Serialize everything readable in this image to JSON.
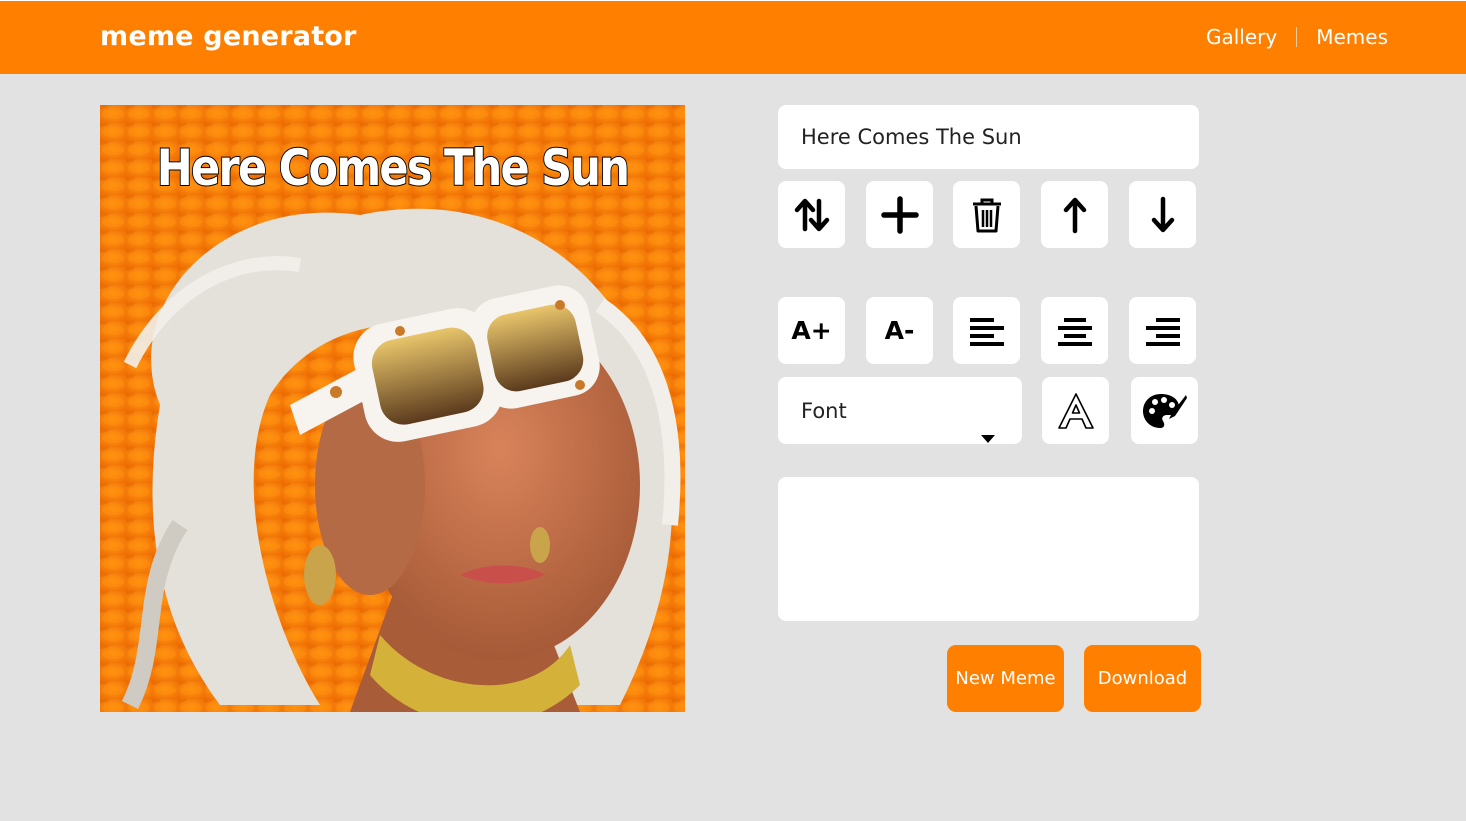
{
  "header": {
    "logo": "meme generator",
    "nav": [
      {
        "label": "Gallery"
      },
      {
        "label": "Memes"
      }
    ]
  },
  "meme": {
    "caption": "Here Comes The Sun"
  },
  "editor": {
    "line_text_value": "Here Comes The Sun",
    "row1": [
      {
        "icon": "swap-vertical-icon",
        "label": ""
      },
      {
        "icon": "plus-icon",
        "label": ""
      },
      {
        "icon": "trash-icon",
        "label": ""
      },
      {
        "icon": "arrow-up-icon",
        "label": ""
      },
      {
        "icon": "arrow-down-icon",
        "label": ""
      }
    ],
    "row2": [
      {
        "icon": "font-increase-icon",
        "label": "A+"
      },
      {
        "icon": "font-decrease-icon",
        "label": "A-"
      },
      {
        "icon": "align-left-icon"
      },
      {
        "icon": "align-center-icon"
      },
      {
        "icon": "align-right-icon"
      }
    ],
    "font_select": {
      "value": "Font"
    },
    "stroke_icon": "outline-a-icon",
    "color_icon": "palette-icon",
    "textarea_value": "",
    "new_meme_label": "New Meme",
    "download_label": "Download"
  },
  "colors": {
    "accent": "#ff7f00",
    "background": "#e2e2e2"
  }
}
